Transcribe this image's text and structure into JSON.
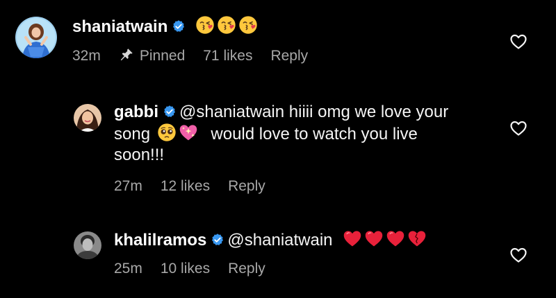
{
  "comments": [
    {
      "username": "shaniatwain",
      "emojis": [
        "kissing-heart",
        "kissing-heart",
        "kissing-heart"
      ],
      "time": "32m",
      "pinned_label": "Pinned",
      "likes": "71 likes",
      "reply": "Reply"
    },
    {
      "username": "gabbi",
      "mention": "@shaniatwain",
      "text_part1": "hiiii omg we love your",
      "text_part2": "song",
      "emojis": [
        "pleading-face",
        "sparkling-heart"
      ],
      "text_part3": "would love to watch you live",
      "text_part4": "soon!!!",
      "time": "27m",
      "likes": "12 likes",
      "reply": "Reply"
    },
    {
      "username": "khalilramos",
      "mention": "@shaniatwain",
      "emojis": [
        "red-heart",
        "red-heart",
        "red-heart",
        "mending-heart"
      ],
      "time": "25m",
      "likes": "10 likes",
      "reply": "Reply"
    }
  ],
  "colors": {
    "background": "#000000",
    "text": "#f5f5f5",
    "secondary": "#a8a8a8",
    "verified": "#3897f0"
  }
}
